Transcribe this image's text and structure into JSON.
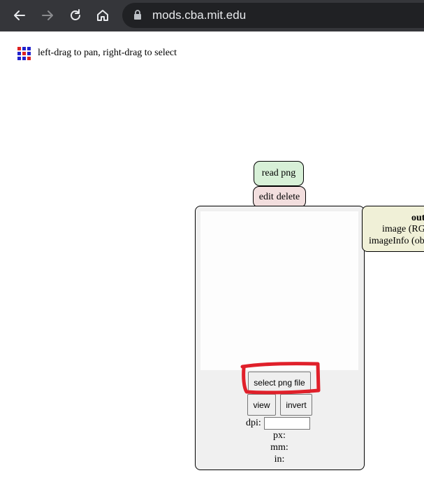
{
  "browser": {
    "url": "mods.cba.mit.edu",
    "icons": [
      "back-arrow-icon",
      "forward-arrow-icon",
      "reload-icon",
      "home-icon",
      "lock-icon"
    ]
  },
  "header": {
    "hint": "left-drag to pan, right-drag to select"
  },
  "module": {
    "title": "read png",
    "actions": {
      "edit": "edit",
      "delete": "delete"
    },
    "select_label": "select png file",
    "view_label": "view",
    "invert_label": "invert",
    "dpi_label": "dpi:",
    "dpi_value": "",
    "px_label": "px:",
    "mm_label": "mm:",
    "in_label": "in:"
  },
  "outputs": {
    "title": "out",
    "items": [
      "image (RG",
      "imageInfo (ob"
    ]
  },
  "colors": {
    "chrome": "#35363a",
    "omnibox": "#202124",
    "title_bg": "#d7f0d7",
    "actions_bg": "#f2dede",
    "outputs_bg": "#f0f0d7",
    "annotation": "#e0202a"
  }
}
